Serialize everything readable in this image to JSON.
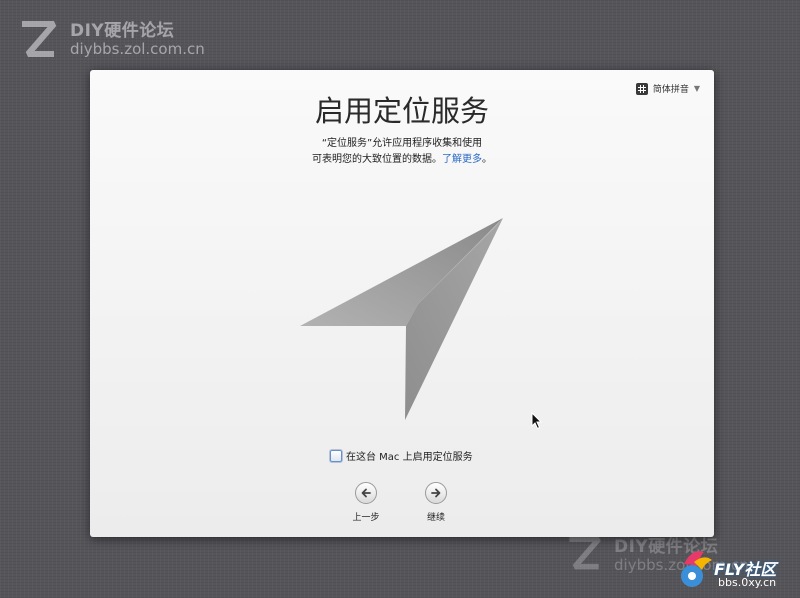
{
  "watermark": {
    "brand": "DIY硬件论坛",
    "url": "diybbs.zol.com.cn"
  },
  "fly_logo": {
    "title": "FLY社区",
    "url": "bbs.0xy.cn"
  },
  "input_source": {
    "label": "简体拼音",
    "icon": "grid-icon"
  },
  "page": {
    "title": "启用定位服务",
    "description_line1": "“定位服务”允许应用程序收集和使用",
    "description_line2": "可表明您的大致位置的数据。",
    "learn_more": "了解更多",
    "description_end": "。"
  },
  "illustration": {
    "icon": "location-arrow-icon"
  },
  "checkbox": {
    "label": "在这台 Mac 上启用定位服务",
    "checked": false
  },
  "nav": {
    "back_label": "上一步",
    "continue_label": "继续"
  },
  "colors": {
    "background": "#55555a",
    "window": "#f2f2f2",
    "link": "#2b6ac7"
  }
}
